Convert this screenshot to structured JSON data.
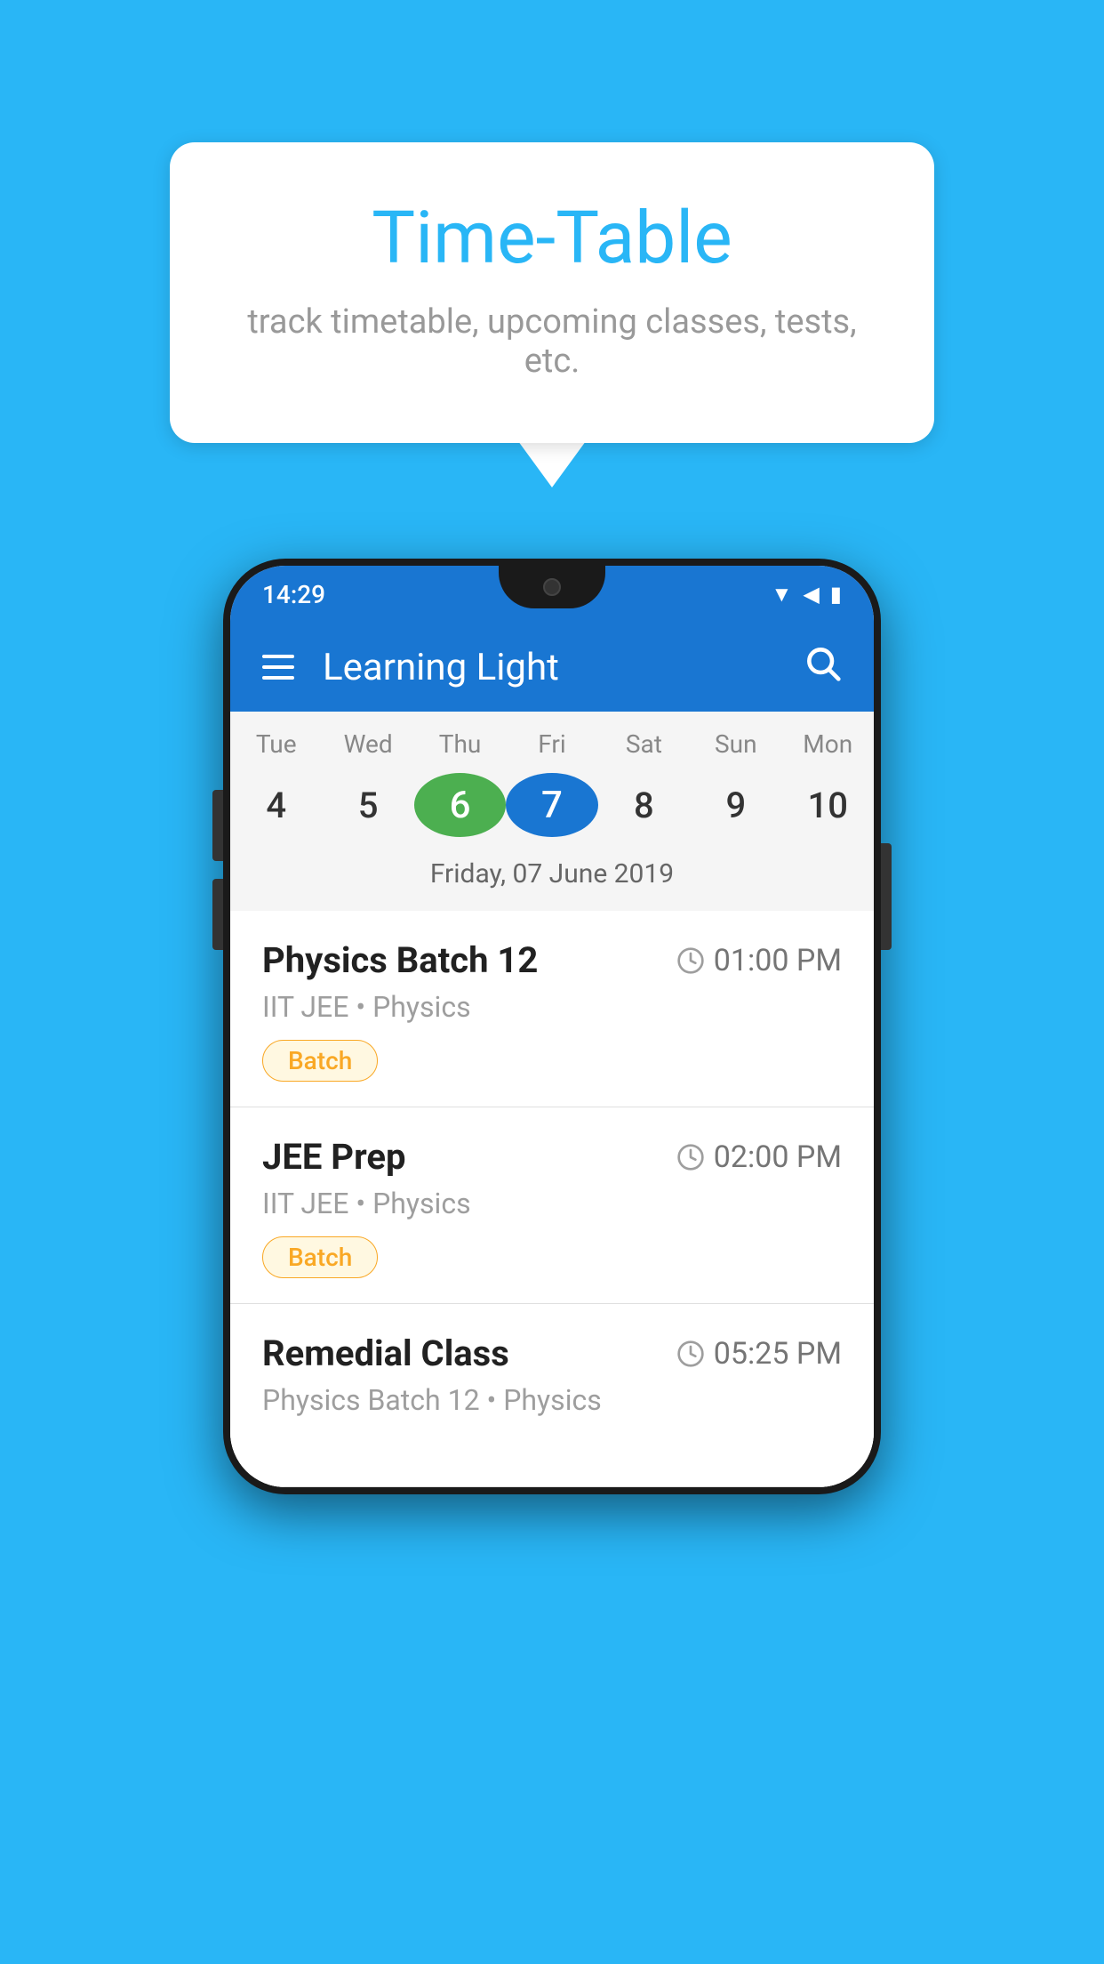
{
  "background_color": "#29B6F6",
  "speech_bubble": {
    "title": "Time-Table",
    "subtitle": "track timetable, upcoming classes, tests, etc."
  },
  "phone": {
    "status_bar": {
      "time": "14:29"
    },
    "app_bar": {
      "title": "Learning Light"
    },
    "calendar": {
      "day_headers": [
        "Tue",
        "Wed",
        "Thu",
        "Fri",
        "Sat",
        "Sun",
        "Mon"
      ],
      "day_numbers": [
        "4",
        "5",
        "6",
        "7",
        "8",
        "9",
        "10"
      ],
      "today_index": 2,
      "selected_index": 3,
      "selected_date_label": "Friday, 07 June 2019"
    },
    "schedule_items": [
      {
        "title": "Physics Batch 12",
        "time": "01:00 PM",
        "subtitle": "IIT JEE • Physics",
        "tag": "Batch"
      },
      {
        "title": "JEE Prep",
        "time": "02:00 PM",
        "subtitle": "IIT JEE • Physics",
        "tag": "Batch"
      },
      {
        "title": "Remedial Class",
        "time": "05:25 PM",
        "subtitle": "Physics Batch 12 • Physics",
        "tag": ""
      }
    ]
  },
  "icons": {
    "hamburger": "☰",
    "search": "🔍",
    "clock": "🕐"
  }
}
